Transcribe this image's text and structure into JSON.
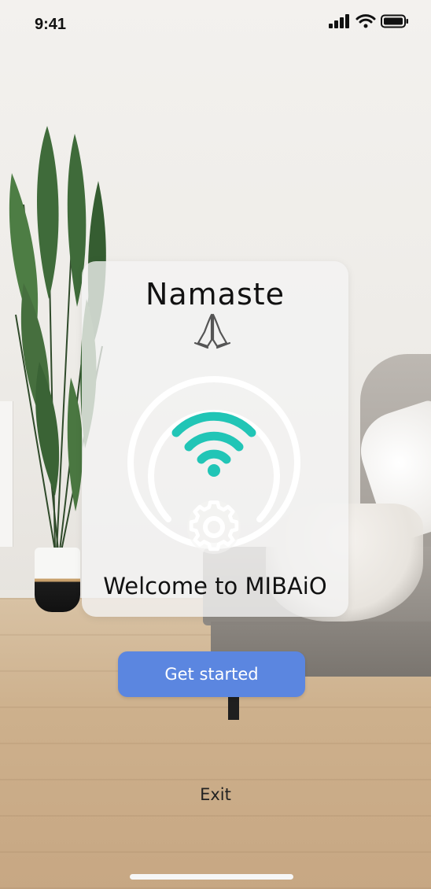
{
  "status_bar": {
    "time": "9:41",
    "icons": [
      "cellular-signal-icon",
      "wifi-icon",
      "battery-icon"
    ]
  },
  "welcome_card": {
    "greeting": "Namaste",
    "greeting_icon": "praying-hands-icon",
    "graphic_icons": [
      "wifi-icon",
      "gear-icon"
    ],
    "welcome_text": "Welcome to MIBAiO"
  },
  "actions": {
    "get_started_label": "Get started",
    "exit_label": "Exit"
  },
  "colors": {
    "primary_button": "#5b86e0",
    "wifi_accent": "#21c5b6",
    "card_background": "#f4f4f3"
  }
}
